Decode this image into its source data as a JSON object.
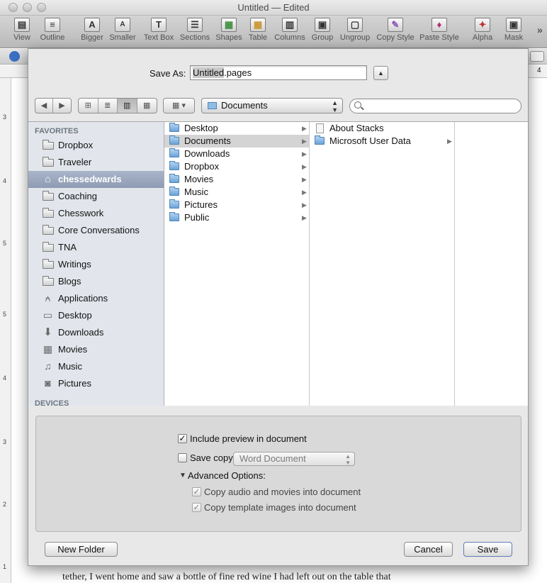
{
  "window": {
    "title": "Untitled — Edited"
  },
  "toolbar": {
    "items": [
      {
        "label": "View",
        "glyph": "▤"
      },
      {
        "label": "Outline",
        "glyph": "≡"
      },
      {
        "label": "Bigger",
        "glyph": "A"
      },
      {
        "label": "Smaller",
        "glyph": "A"
      },
      {
        "label": "Text Box",
        "glyph": "T"
      },
      {
        "label": "Sections",
        "glyph": "☰"
      },
      {
        "label": "Shapes",
        "glyph": "▦"
      },
      {
        "label": "Table",
        "glyph": "▦"
      },
      {
        "label": "Columns",
        "glyph": "▥"
      },
      {
        "label": "Group",
        "glyph": "▣"
      },
      {
        "label": "Ungroup",
        "glyph": "▢"
      },
      {
        "label": "Copy Style",
        "glyph": "✎"
      },
      {
        "label": "Paste Style",
        "glyph": "♦"
      },
      {
        "label": "Alpha",
        "glyph": "✦"
      },
      {
        "label": "Mask",
        "glyph": "▣"
      }
    ],
    "overflow": "»"
  },
  "ruler_left_numbers": [
    "3",
    "4",
    "5",
    "5",
    "4",
    "3",
    "2",
    "1"
  ],
  "ruler_top_number": "4",
  "document_bottom_text": "tether, I went home and saw a bottle of fine red wine I had left out on the table that",
  "dialog": {
    "save_as_label": "Save As:",
    "filename_selected": "Untitled",
    "filename_ext": ".pages",
    "location": "Documents",
    "search_placeholder": "",
    "nav": {
      "back": "◀",
      "forward": "▶"
    },
    "view_modes": [
      "⊞",
      "≣",
      "▥",
      "▦"
    ],
    "arrange_glyph": "▦ ▾"
  },
  "sidebar": {
    "favorites_header": "FAVORITES",
    "devices_header": "DEVICES",
    "items": [
      {
        "label": "Dropbox",
        "icon": "folder-icon"
      },
      {
        "label": "Traveler",
        "icon": "folder-icon"
      },
      {
        "label": "chessedwards",
        "icon": "home-icon",
        "selected": true
      },
      {
        "label": "Coaching",
        "icon": "folder-icon"
      },
      {
        "label": "Chesswork",
        "icon": "folder-icon"
      },
      {
        "label": "Core Conversations",
        "icon": "folder-icon"
      },
      {
        "label": "TNA",
        "icon": "folder-icon"
      },
      {
        "label": "Writings",
        "icon": "folder-icon"
      },
      {
        "label": "Blogs",
        "icon": "folder-icon"
      },
      {
        "label": "Applications",
        "icon": "applications-icon"
      },
      {
        "label": "Desktop",
        "icon": "desktop-icon"
      },
      {
        "label": "Downloads",
        "icon": "downloads-icon"
      },
      {
        "label": "Movies",
        "icon": "movies-icon"
      },
      {
        "label": "Music",
        "icon": "music-icon"
      },
      {
        "label": "Pictures",
        "icon": "pictures-icon"
      }
    ]
  },
  "column1": [
    {
      "label": "Desktop"
    },
    {
      "label": "Documents",
      "selected": true
    },
    {
      "label": "Downloads"
    },
    {
      "label": "Dropbox"
    },
    {
      "label": "Movies"
    },
    {
      "label": "Music"
    },
    {
      "label": "Pictures"
    },
    {
      "label": "Public"
    }
  ],
  "column2": [
    {
      "label": "About Stacks",
      "kind": "document"
    },
    {
      "label": "Microsoft User Data",
      "kind": "folder"
    }
  ],
  "options": {
    "include_preview": {
      "label": "Include preview in document",
      "checked": true
    },
    "save_copy": {
      "label": "Save copy as:",
      "checked": false,
      "format": "Word Document"
    },
    "advanced_label": "Advanced Options:",
    "copy_audio": {
      "label": "Copy audio and movies into document",
      "checked": true
    },
    "copy_template": {
      "label": "Copy template images into document",
      "checked": true
    }
  },
  "buttons": {
    "new_folder": "New Folder",
    "cancel": "Cancel",
    "save": "Save"
  }
}
